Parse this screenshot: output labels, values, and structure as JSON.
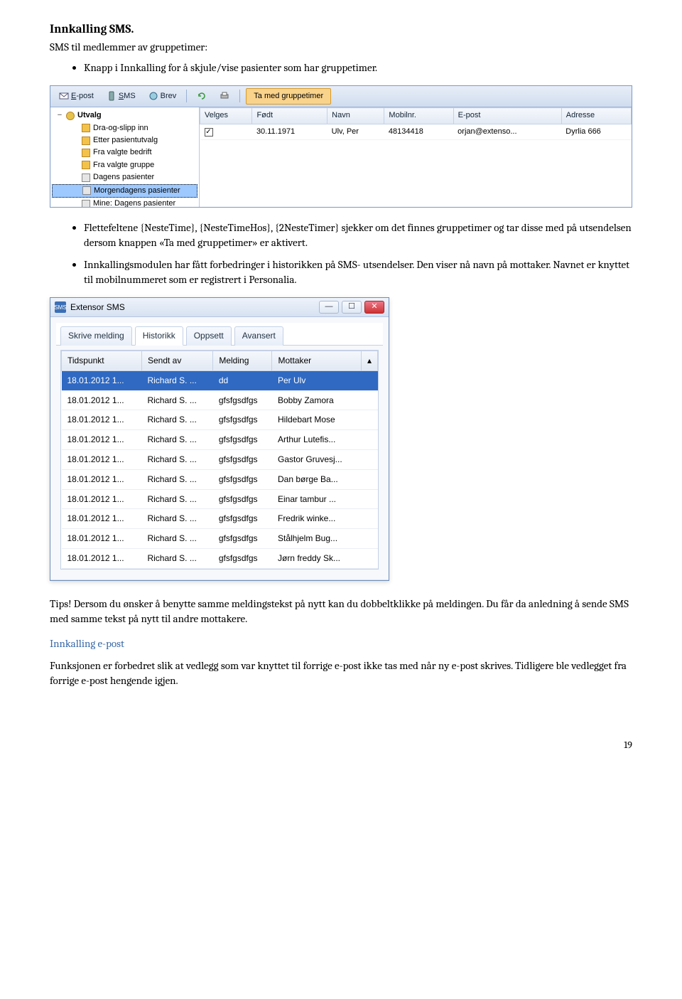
{
  "heading1": "Innkalling SMS.",
  "intro1": "SMS til medlemmer av gruppetimer:",
  "bullet1": "Knapp i Innkalling for å skjule/vise pasienter som har gruppetimer.",
  "shot1": {
    "toolbar": {
      "epost": "E-post",
      "sms": "SMS",
      "brev": "Brev",
      "highlight": "Ta med gruppetimer"
    },
    "tree": {
      "root": "Utvalg",
      "items": [
        "Dra-og-slipp inn",
        "Etter pasientutvalg",
        "Fra valgte bedrift",
        "Fra valgte gruppe",
        "Dagens pasienter",
        "Morgendagens pasienter",
        "Mine: Dagens pasienter"
      ],
      "selectedIndex": 5
    },
    "grid": {
      "cols": [
        "Velges",
        "Født",
        "Navn",
        "Mobilnr.",
        "E-post",
        "Adresse"
      ],
      "row": {
        "checked": "✓",
        "fodt": "30.11.1971",
        "navn": "Ulv, Per",
        "mobil": "48134418",
        "epost": "orjan@extenso...",
        "adresse": "Dyrlia 666"
      }
    }
  },
  "bullet2": "Flettefeltene {NesteTime}, {NesteTimeHos}, {2NesteTimer} sjekker om det finnes gruppetimer og tar disse med på utsendelsen dersom knappen «Ta med gruppetimer» er aktivert.",
  "bullet3": "Innkallingsmodulen har fått forbedringer i historikken på SMS- utsendelser. Den viser nå navn på mottaker. Navnet er knyttet til mobilnummeret som er registrert i Personalia.",
  "shot2": {
    "title": "Extensor SMS",
    "tabs": [
      "Skrive melding",
      "Historikk",
      "Oppsett",
      "Avansert"
    ],
    "activeTab": 1,
    "cols": [
      "Tidspunkt",
      "Sendt av",
      "Melding",
      "Mottaker"
    ],
    "rows": [
      {
        "t": "18.01.2012 1...",
        "s": "Richard S. ...",
        "m": "dd",
        "r": "Per Ulv"
      },
      {
        "t": "18.01.2012 1...",
        "s": "Richard S. ...",
        "m": "gfsfgsdfgs",
        "r": "Bobby Zamora"
      },
      {
        "t": "18.01.2012 1...",
        "s": "Richard S. ...",
        "m": "gfsfgsdfgs",
        "r": "Hildebart Mose"
      },
      {
        "t": "18.01.2012 1...",
        "s": "Richard S. ...",
        "m": "gfsfgsdfgs",
        "r": "Arthur Lutefis..."
      },
      {
        "t": "18.01.2012 1...",
        "s": "Richard S. ...",
        "m": "gfsfgsdfgs",
        "r": "Gastor Gruvesj..."
      },
      {
        "t": "18.01.2012 1...",
        "s": "Richard S. ...",
        "m": "gfsfgsdfgs",
        "r": "Dan børge Ba..."
      },
      {
        "t": "18.01.2012 1...",
        "s": "Richard S. ...",
        "m": "gfsfgsdfgs",
        "r": "Einar tambur ..."
      },
      {
        "t": "18.01.2012 1...",
        "s": "Richard S. ...",
        "m": "gfsfgsdfgs",
        "r": "Fredrik winke..."
      },
      {
        "t": "18.01.2012 1...",
        "s": "Richard S. ...",
        "m": "gfsfgsdfgs",
        "r": "Stålhjelm Bug..."
      },
      {
        "t": "18.01.2012 1...",
        "s": "Richard S. ...",
        "m": "gfsfgsdfgs",
        "r": "Jørn freddy Sk..."
      }
    ],
    "selectedRow": 0
  },
  "tips": "Tips! Dersom du ønsker å benytte samme meldingstekst på nytt kan du dobbeltklikke på meldingen. Du får da anledning å sende SMS med samme tekst på nytt til andre mottakere.",
  "heading2": "Innkalling e-post",
  "para2": "Funksjonen er forbedret slik at vedlegg som var knyttet til forrige e-post ikke tas med når ny e-post skrives. Tidligere ble vedlegget fra forrige e-post hengende igjen.",
  "pageNumber": "19"
}
